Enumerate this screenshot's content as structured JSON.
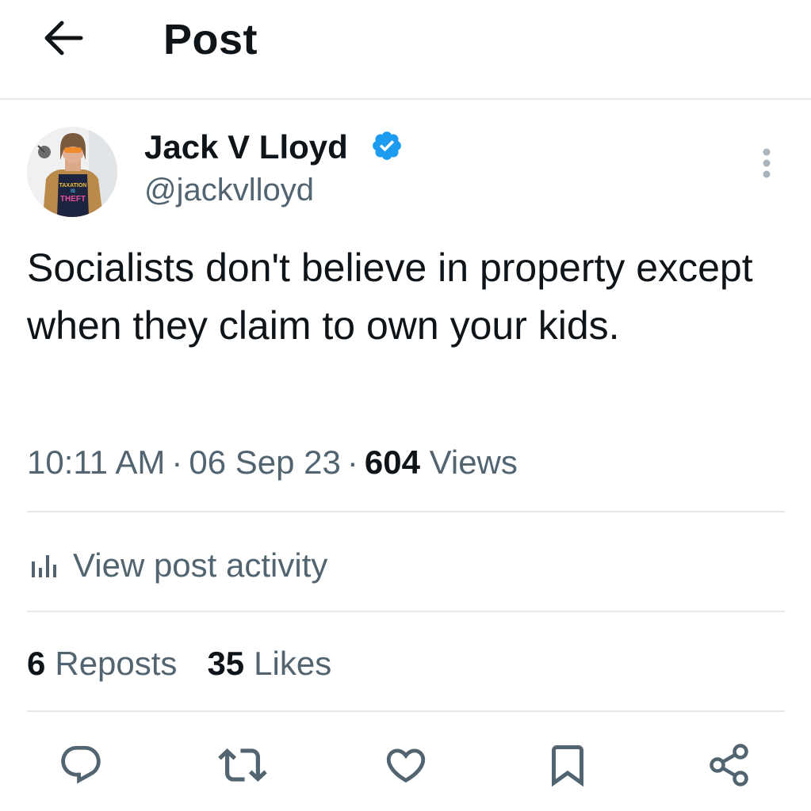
{
  "header": {
    "title": "Post"
  },
  "author": {
    "name": "Jack V Lloyd",
    "handle": "@jackvlloyd",
    "verified": true,
    "avatar_shirt_text": [
      "TAXATION",
      "IS",
      "THEFT"
    ]
  },
  "post": {
    "text": "Socialists don't believe in property except when they claim to own your kids.",
    "time": "10:11 AM",
    "date": "06 Sep 23",
    "separator": "·",
    "views_count": "604",
    "views_label": "Views"
  },
  "activity": {
    "label": "View post activity"
  },
  "stats": {
    "reposts_count": "6",
    "reposts_label": "Reposts",
    "likes_count": "35",
    "likes_label": "Likes"
  },
  "actions": {
    "icons": [
      "reply-icon",
      "repost-icon",
      "like-icon",
      "bookmark-icon",
      "share-icon"
    ]
  },
  "colors": {
    "text": "#0f1419",
    "secondary": "#536471",
    "verified_blue": "#1d9bf0",
    "divider": "#e6e8ea"
  }
}
